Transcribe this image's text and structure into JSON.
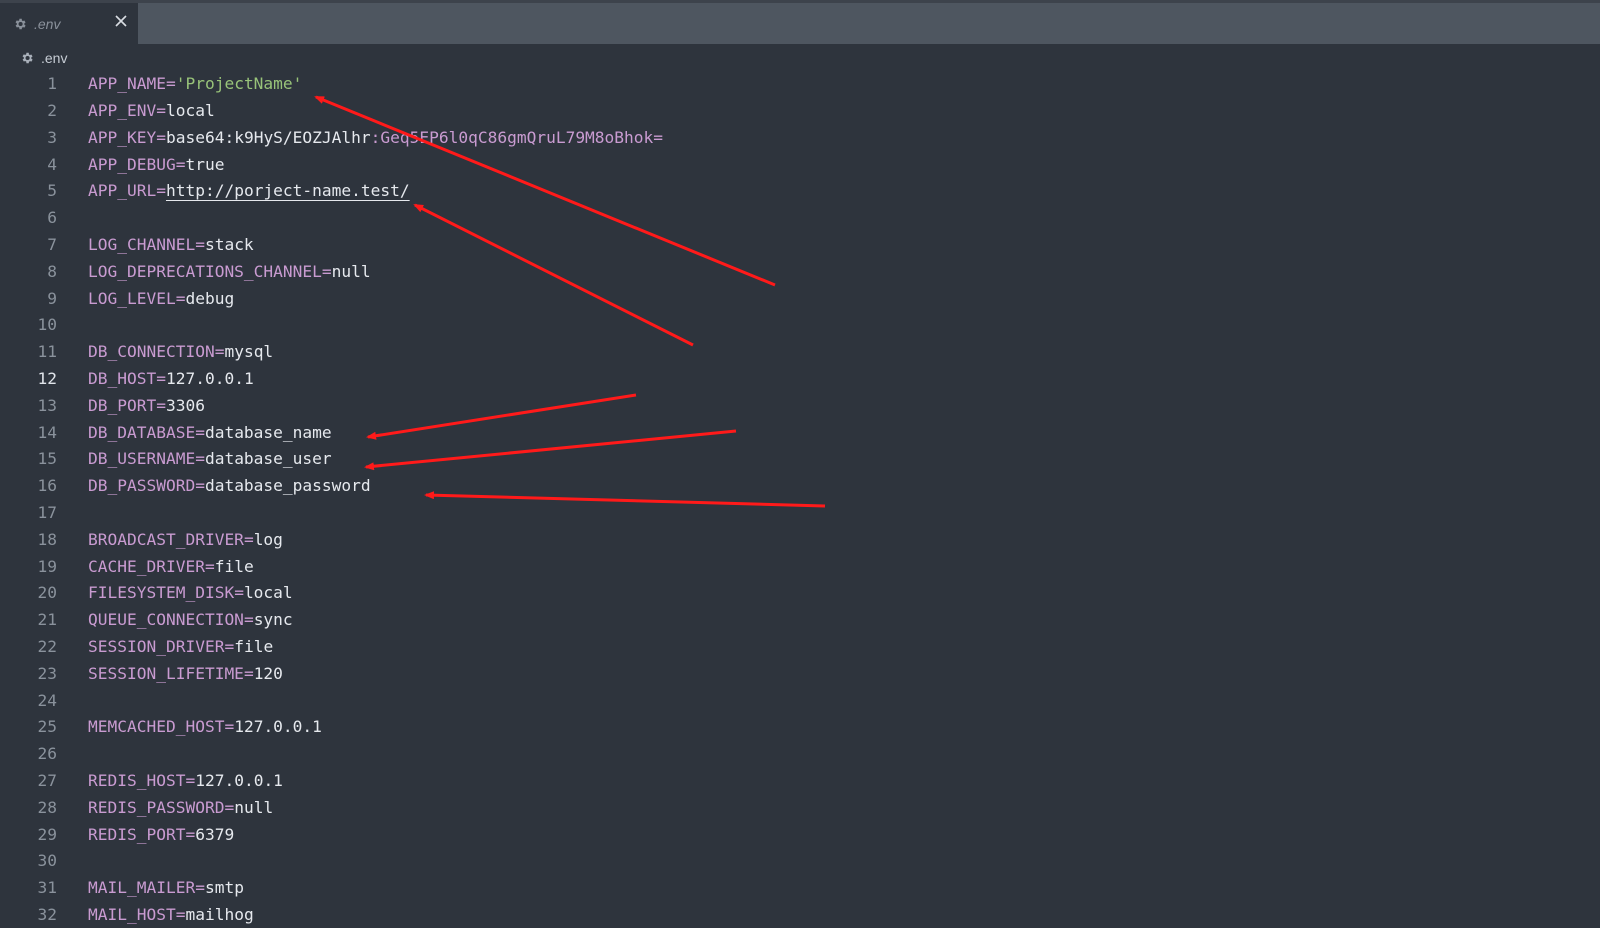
{
  "tab": {
    "label": ".env",
    "icon": "gear-icon",
    "close_icon": "close-icon"
  },
  "breadcrumb": {
    "label": ".env",
    "icon": "gear-icon"
  },
  "active_line": 12,
  "colors": {
    "key": "#c99bd1",
    "value": "#e6e9ee",
    "string": "#98c379",
    "annotation": "#ff1a1a"
  },
  "lines": [
    {
      "n": "1",
      "parts": [
        [
          "k",
          "APP_NAME"
        ],
        [
          "eq",
          "="
        ],
        [
          "s",
          "'ProjectName'"
        ]
      ]
    },
    {
      "n": "2",
      "parts": [
        [
          "k",
          "APP_ENV"
        ],
        [
          "eq",
          "="
        ],
        [
          "v",
          "local"
        ]
      ]
    },
    {
      "n": "3",
      "parts": [
        [
          "k",
          "APP_KEY"
        ],
        [
          "eq",
          "="
        ],
        [
          "v",
          "base64:k9HyS/EOZJAlhr"
        ],
        [
          "m",
          ":Geq5EP6l0qC86gmQruL79M8oBhok="
        ]
      ]
    },
    {
      "n": "4",
      "parts": [
        [
          "k",
          "APP_DEBUG"
        ],
        [
          "eq",
          "="
        ],
        [
          "v",
          "true"
        ]
      ]
    },
    {
      "n": "5",
      "parts": [
        [
          "k",
          "APP_URL"
        ],
        [
          "eq",
          "="
        ],
        [
          "u",
          "http://porject-name.test/"
        ]
      ]
    },
    {
      "n": "6",
      "parts": []
    },
    {
      "n": "7",
      "parts": [
        [
          "k",
          "LOG_CHANNEL"
        ],
        [
          "eq",
          "="
        ],
        [
          "v",
          "stack"
        ]
      ]
    },
    {
      "n": "8",
      "parts": [
        [
          "k",
          "LOG_DEPRECATIONS_CHANNEL"
        ],
        [
          "eq",
          "="
        ],
        [
          "v",
          "null"
        ]
      ]
    },
    {
      "n": "9",
      "parts": [
        [
          "k",
          "LOG_LEVEL"
        ],
        [
          "eq",
          "="
        ],
        [
          "v",
          "debug"
        ]
      ]
    },
    {
      "n": "10",
      "parts": []
    },
    {
      "n": "11",
      "parts": [
        [
          "k",
          "DB_CONNECTION"
        ],
        [
          "eq",
          "="
        ],
        [
          "v",
          "mysql"
        ]
      ]
    },
    {
      "n": "12",
      "parts": [
        [
          "k",
          "DB_HOST"
        ],
        [
          "eq",
          "="
        ],
        [
          "v",
          "127.0.0.1"
        ]
      ]
    },
    {
      "n": "13",
      "parts": [
        [
          "k",
          "DB_PORT"
        ],
        [
          "eq",
          "="
        ],
        [
          "v",
          "3306"
        ]
      ]
    },
    {
      "n": "14",
      "parts": [
        [
          "k",
          "DB_DATABASE"
        ],
        [
          "eq",
          "="
        ],
        [
          "v",
          "database_name"
        ]
      ]
    },
    {
      "n": "15",
      "parts": [
        [
          "k",
          "DB_USERNAME"
        ],
        [
          "eq",
          "="
        ],
        [
          "v",
          "database_user"
        ]
      ]
    },
    {
      "n": "16",
      "parts": [
        [
          "k",
          "DB_PASSWORD"
        ],
        [
          "eq",
          "="
        ],
        [
          "v",
          "database_password"
        ]
      ]
    },
    {
      "n": "17",
      "parts": []
    },
    {
      "n": "18",
      "parts": [
        [
          "k",
          "BROADCAST_DRIVER"
        ],
        [
          "eq",
          "="
        ],
        [
          "v",
          "log"
        ]
      ]
    },
    {
      "n": "19",
      "parts": [
        [
          "k",
          "CACHE_DRIVER"
        ],
        [
          "eq",
          "="
        ],
        [
          "v",
          "file"
        ]
      ]
    },
    {
      "n": "20",
      "parts": [
        [
          "k",
          "FILESYSTEM_DISK"
        ],
        [
          "eq",
          "="
        ],
        [
          "v",
          "local"
        ]
      ]
    },
    {
      "n": "21",
      "parts": [
        [
          "k",
          "QUEUE_CONNECTION"
        ],
        [
          "eq",
          "="
        ],
        [
          "v",
          "sync"
        ]
      ]
    },
    {
      "n": "22",
      "parts": [
        [
          "k",
          "SESSION_DRIVER"
        ],
        [
          "eq",
          "="
        ],
        [
          "v",
          "file"
        ]
      ]
    },
    {
      "n": "23",
      "parts": [
        [
          "k",
          "SESSION_LIFETIME"
        ],
        [
          "eq",
          "="
        ],
        [
          "v",
          "120"
        ]
      ]
    },
    {
      "n": "24",
      "parts": []
    },
    {
      "n": "25",
      "parts": [
        [
          "k",
          "MEMCACHED_HOST"
        ],
        [
          "eq",
          "="
        ],
        [
          "v",
          "127.0.0.1"
        ]
      ]
    },
    {
      "n": "26",
      "parts": []
    },
    {
      "n": "27",
      "parts": [
        [
          "k",
          "REDIS_HOST"
        ],
        [
          "eq",
          "="
        ],
        [
          "v",
          "127.0.0.1"
        ]
      ]
    },
    {
      "n": "28",
      "parts": [
        [
          "k",
          "REDIS_PASSWORD"
        ],
        [
          "eq",
          "="
        ],
        [
          "v",
          "null"
        ]
      ]
    },
    {
      "n": "29",
      "parts": [
        [
          "k",
          "REDIS_PORT"
        ],
        [
          "eq",
          "="
        ],
        [
          "v",
          "6379"
        ]
      ]
    },
    {
      "n": "30",
      "parts": []
    },
    {
      "n": "31",
      "parts": [
        [
          "k",
          "MAIL_MAILER"
        ],
        [
          "eq",
          "="
        ],
        [
          "v",
          "smtp"
        ]
      ]
    },
    {
      "n": "32",
      "parts": [
        [
          "k",
          "MAIL_HOST"
        ],
        [
          "eq",
          "="
        ],
        [
          "v",
          "mailhog"
        ]
      ]
    }
  ]
}
